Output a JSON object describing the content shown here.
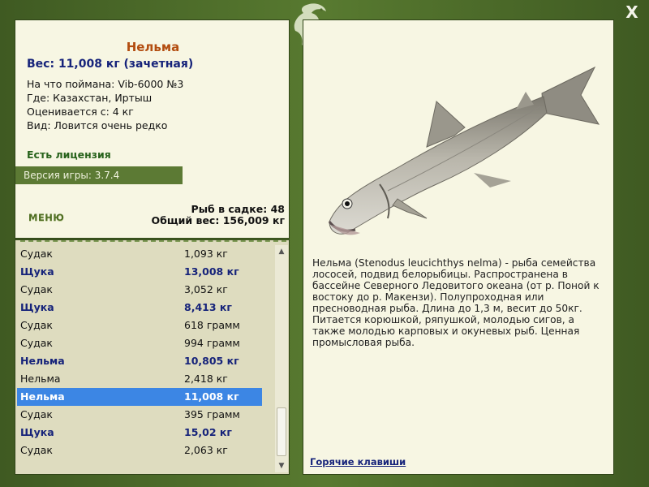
{
  "window": {
    "close_label": "X"
  },
  "info": {
    "fish_name": "Нельма",
    "weight_line": "Вес: 11,008 кг (зачетная)",
    "caught_on": "На что поймана: Vib-6000 №3",
    "where": "Где: Казахстан, Иртыш",
    "rated_from": "Оценивается с: 4 кг",
    "kind": "Вид: Ловится очень редко",
    "license": "Есть лицензия",
    "version": "Версия игры: 3.7.4",
    "menu_label": "МЕНЮ",
    "fish_count": "Рыб в садке: 48",
    "total_weight": "Общий вес: 156,009 кг"
  },
  "catch_list": [
    {
      "name": "Судак",
      "weight": "1,093 кг",
      "record": false,
      "selected": false
    },
    {
      "name": "Щука",
      "weight": "13,008 кг",
      "record": true,
      "selected": false
    },
    {
      "name": "Судак",
      "weight": "3,052 кг",
      "record": false,
      "selected": false
    },
    {
      "name": "Щука",
      "weight": "8,413 кг",
      "record": true,
      "selected": false
    },
    {
      "name": "Судак",
      "weight": "618 грамм",
      "record": false,
      "selected": false
    },
    {
      "name": "Судак",
      "weight": "994 грамм",
      "record": false,
      "selected": false
    },
    {
      "name": "Нельма",
      "weight": "10,805 кг",
      "record": true,
      "selected": false
    },
    {
      "name": "Нельма",
      "weight": "2,418 кг",
      "record": false,
      "selected": false
    },
    {
      "name": "Нельма",
      "weight": "11,008 кг",
      "record": true,
      "selected": true
    },
    {
      "name": "Судак",
      "weight": "395 грамм",
      "record": false,
      "selected": false
    },
    {
      "name": "Щука",
      "weight": "15,02 кг",
      "record": true,
      "selected": false
    },
    {
      "name": "Судак",
      "weight": "2,063 кг",
      "record": false,
      "selected": false
    }
  ],
  "description": "Нельма (Stenodus leucichthys nelma) - рыба семейства лососей, подвид белорыбицы. Распространена в бассейне Северного Ледовитого океана (от р. Поной к востоку до р. Макензи). Полупроходная или пресноводная рыба. Длина до 1,3 м, весит до 50кг. Питается корюшкой, ряпушкой, молодью сигов, а также молодью карповых и окуневых рыб. Ценная промысловая рыба.",
  "hotkeys_label": "Горячие клавиши",
  "icons": {
    "close": "close-icon",
    "logo": "fish-logo-icon",
    "scroll_up": "arrow-up-icon",
    "scroll_down": "arrow-down-icon"
  },
  "colors": {
    "frame": "#4e6a2b",
    "panel": "#f7f6e3",
    "record_text": "#16237a",
    "selection": "#3c86e4",
    "fish_name": "#b34d10",
    "license": "#27621b"
  }
}
